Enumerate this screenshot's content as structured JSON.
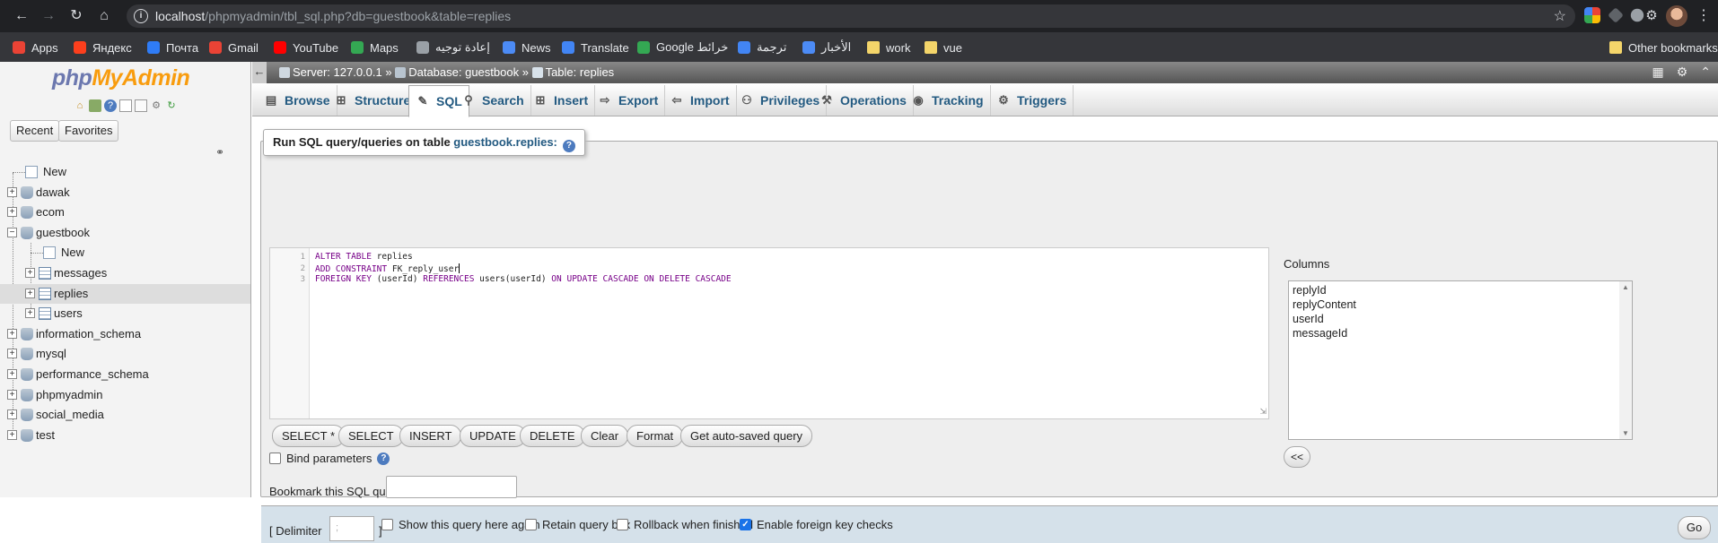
{
  "browser": {
    "url_host": "localhost",
    "url_path": "/phpmyadmin/tbl_sql.php?db=guestbook&table=replies",
    "bookmarks": [
      {
        "label": "Apps",
        "color": "#ea4335"
      },
      {
        "label": "Яндекс",
        "color": "#fc3f1d"
      },
      {
        "label": "Почта",
        "color": "#2f7cf6"
      },
      {
        "label": "Gmail",
        "color": "#ea4335"
      },
      {
        "label": "YouTube",
        "color": "#ff0000"
      },
      {
        "label": "Maps",
        "color": "#34a853"
      },
      {
        "label": "إعادة توجيه",
        "color": "#9aa0a6"
      },
      {
        "label": "News",
        "color": "#4c8bf5"
      },
      {
        "label": "Translate",
        "color": "#4285f4"
      },
      {
        "label": "Google خرائط",
        "color": "#34a853"
      },
      {
        "label": "ترجمة",
        "color": "#4285f4"
      },
      {
        "label": "الأخبار",
        "color": "#4c8bf5"
      },
      {
        "label": "work",
        "color": "#f4d56a"
      },
      {
        "label": "vue",
        "color": "#f4d56a"
      }
    ],
    "other_bookmarks": "Other bookmarks"
  },
  "sidebar": {
    "logo_php": "php",
    "logo_myadmin": "MyAdmin",
    "recent_label": "Recent",
    "favorites_label": "Favorites",
    "tree": [
      {
        "label": "New",
        "type": "new"
      },
      {
        "label": "dawak",
        "type": "db"
      },
      {
        "label": "ecom",
        "type": "db"
      },
      {
        "label": "guestbook",
        "type": "db-open"
      },
      {
        "label": "New",
        "type": "new-child"
      },
      {
        "label": "messages",
        "type": "table"
      },
      {
        "label": "replies",
        "type": "table-selected"
      },
      {
        "label": "users",
        "type": "table"
      },
      {
        "label": "information_schema",
        "type": "db"
      },
      {
        "label": "mysql",
        "type": "db"
      },
      {
        "label": "performance_schema",
        "type": "db"
      },
      {
        "label": "phpmyadmin",
        "type": "db"
      },
      {
        "label": "social_media",
        "type": "db"
      },
      {
        "label": "test",
        "type": "db"
      }
    ]
  },
  "breadcrumb": {
    "server": "Server: 127.0.0.1",
    "database": "Database: guestbook",
    "table": "Table: replies",
    "sep": "»"
  },
  "tabs": [
    {
      "label": "Browse",
      "icon": "browse-icon"
    },
    {
      "label": "Structure",
      "icon": "structure-icon"
    },
    {
      "label": "SQL",
      "icon": "sql-icon",
      "active": true
    },
    {
      "label": "Search",
      "icon": "search-icon"
    },
    {
      "label": "Insert",
      "icon": "insert-icon"
    },
    {
      "label": "Export",
      "icon": "export-icon"
    },
    {
      "label": "Import",
      "icon": "import-icon"
    },
    {
      "label": "Privileges",
      "icon": "privileges-icon"
    },
    {
      "label": "Operations",
      "icon": "operations-icon"
    },
    {
      "label": "Tracking",
      "icon": "tracking-icon"
    },
    {
      "label": "Triggers",
      "icon": "triggers-icon"
    }
  ],
  "sql_panel": {
    "legend_prefix": "Run SQL query/queries on table ",
    "legend_table": "guestbook.replies:",
    "lines": [
      {
        "num": "1",
        "text": "ALTER TABLE replies"
      },
      {
        "num": "2",
        "text": "ADD CONSTRAINT FK_reply_user"
      },
      {
        "num": "3",
        "text": "FOREIGN KEY (userId) REFERENCES users(userId) ON UPDATE CASCADE ON DELETE CASCADE"
      }
    ],
    "buttons": [
      "SELECT *",
      "SELECT",
      "INSERT",
      "UPDATE",
      "DELETE",
      "Clear",
      "Format",
      "Get auto-saved query"
    ],
    "bind_parameters": "Bind parameters",
    "bookmark_label": "Bookmark this SQL query:",
    "columns_label": "Columns",
    "columns": [
      "replyId",
      "replyContent",
      "userId",
      "messageId"
    ],
    "insert_column_button": "<<"
  },
  "footer": {
    "delimiter_label": "[ Delimiter",
    "delimiter_value": ";",
    "delimiter_close": "]",
    "show_query_again": "Show this query here again",
    "retain_query_box": "Retain query box",
    "rollback_when_finished": "Rollback when finished",
    "enable_fk_checks": "Enable foreign key checks",
    "enable_fk_checks_checked": true,
    "go_label": "Go"
  }
}
